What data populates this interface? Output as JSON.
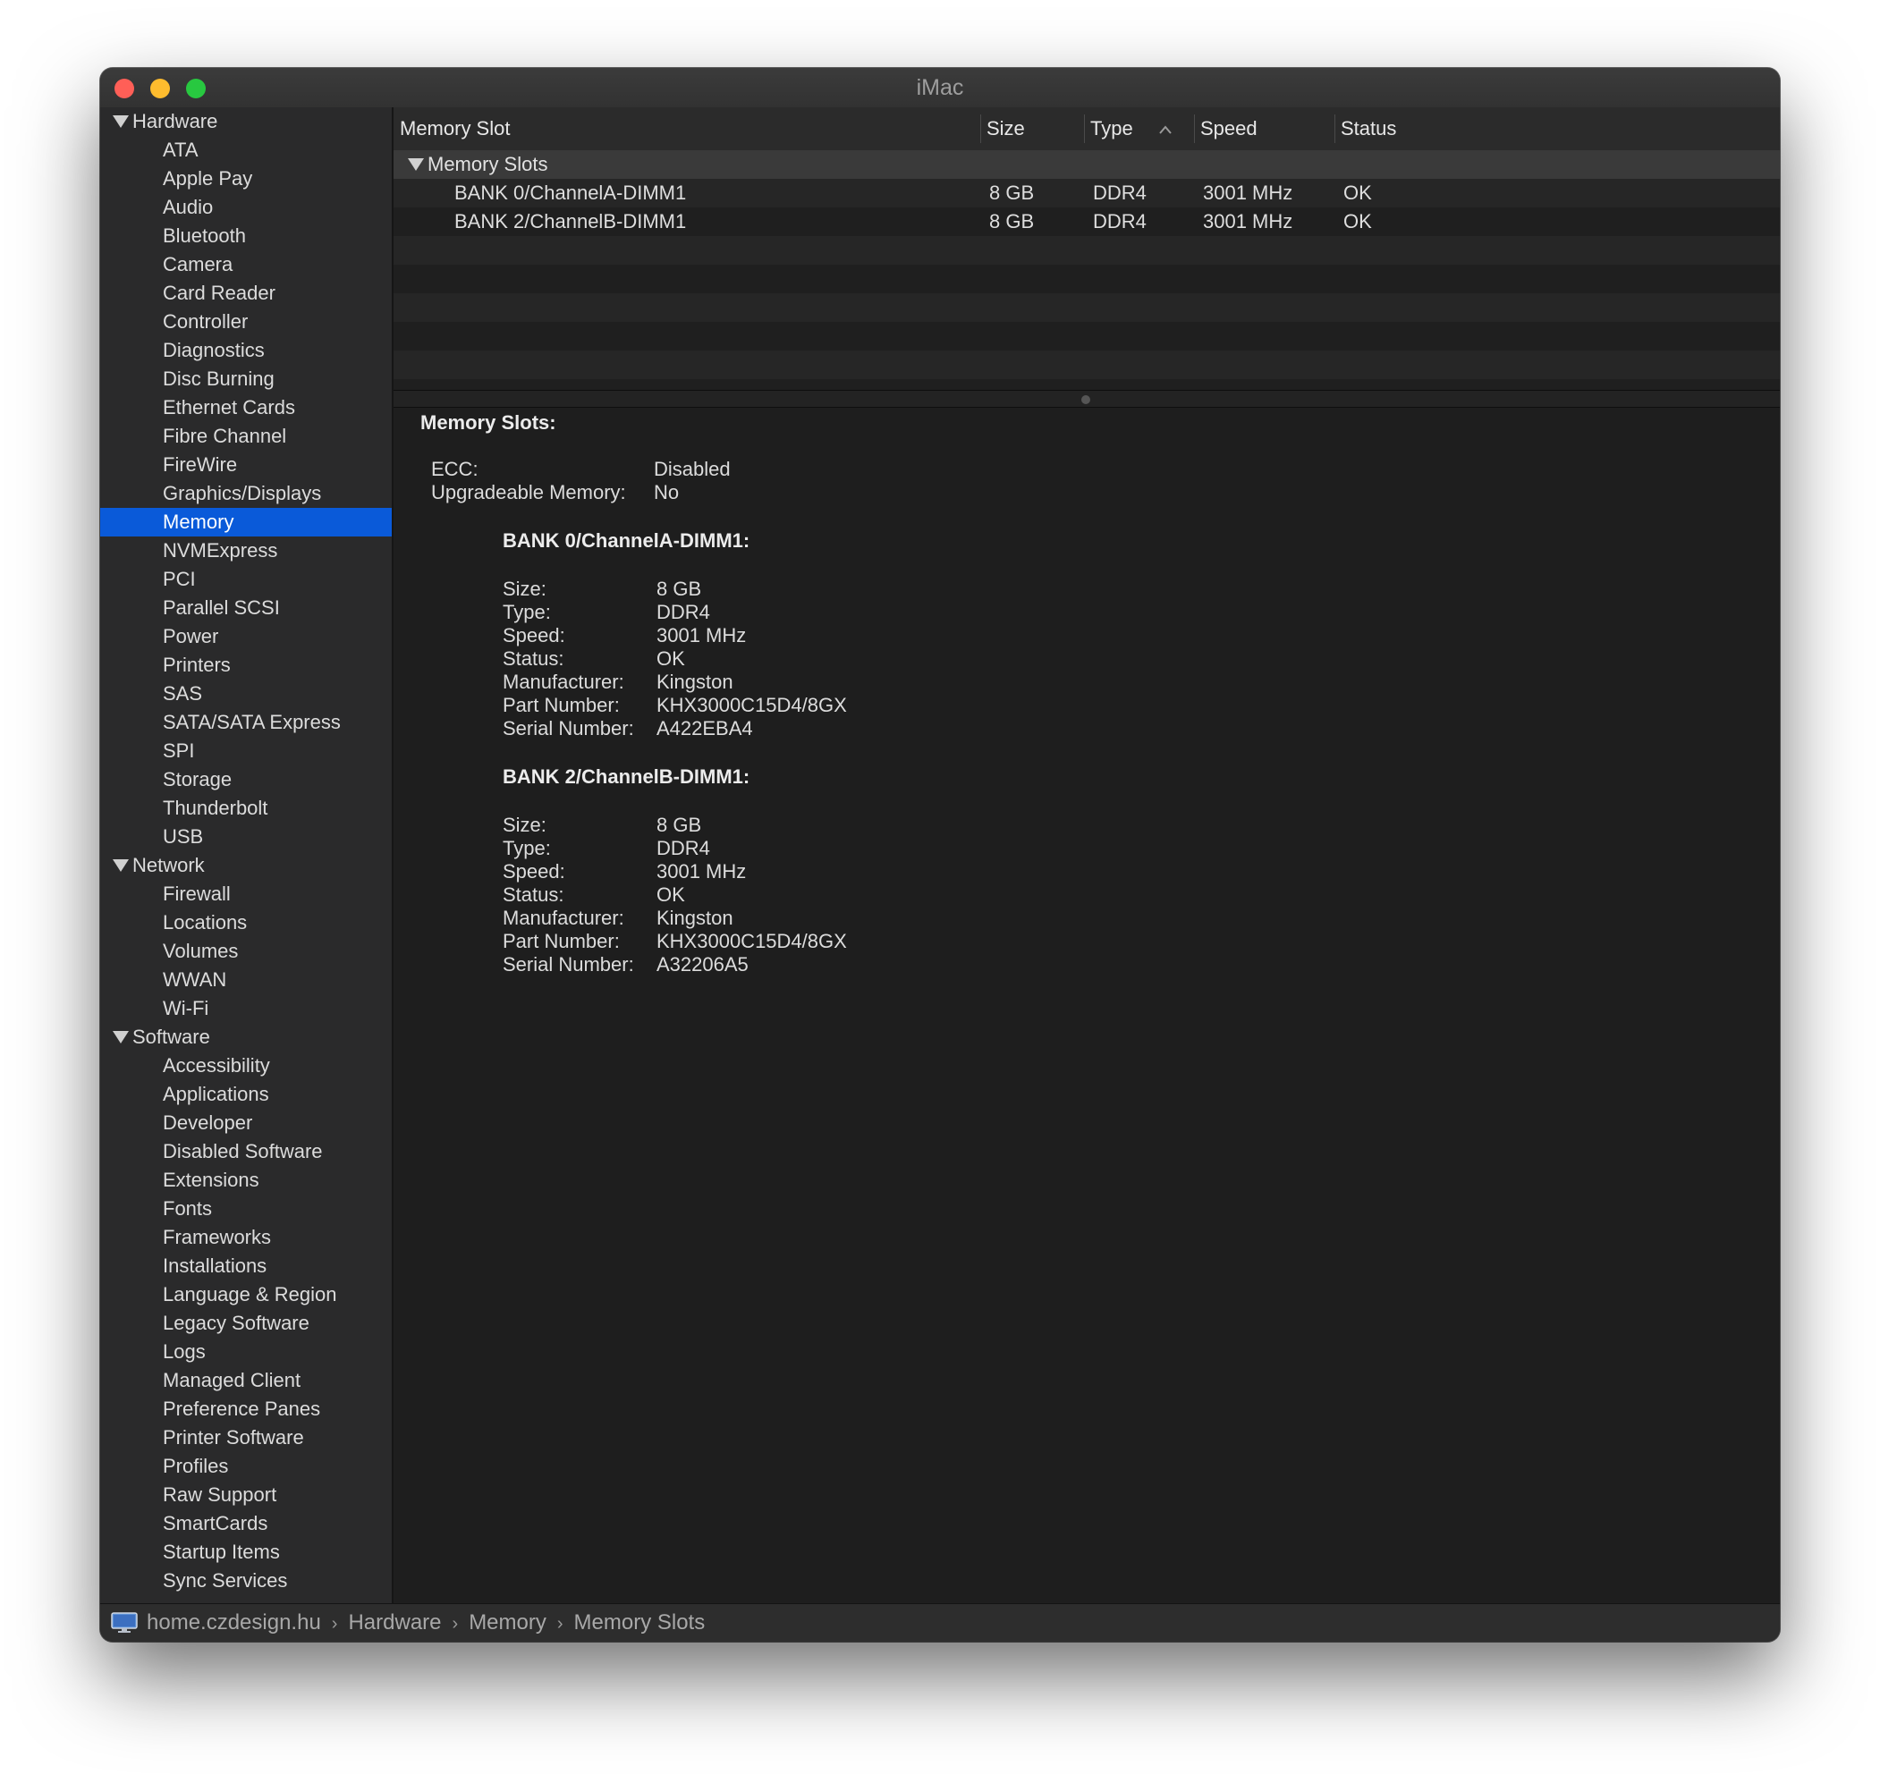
{
  "window": {
    "title": "iMac"
  },
  "sidebar": {
    "groups": [
      {
        "label": "Hardware",
        "items": [
          "ATA",
          "Apple Pay",
          "Audio",
          "Bluetooth",
          "Camera",
          "Card Reader",
          "Controller",
          "Diagnostics",
          "Disc Burning",
          "Ethernet Cards",
          "Fibre Channel",
          "FireWire",
          "Graphics/Displays",
          "Memory",
          "NVMExpress",
          "PCI",
          "Parallel SCSI",
          "Power",
          "Printers",
          "SAS",
          "SATA/SATA Express",
          "SPI",
          "Storage",
          "Thunderbolt",
          "USB"
        ]
      },
      {
        "label": "Network",
        "items": [
          "Firewall",
          "Locations",
          "Volumes",
          "WWAN",
          "Wi-Fi"
        ]
      },
      {
        "label": "Software",
        "items": [
          "Accessibility",
          "Applications",
          "Developer",
          "Disabled Software",
          "Extensions",
          "Fonts",
          "Frameworks",
          "Installations",
          "Language & Region",
          "Legacy Software",
          "Logs",
          "Managed Client",
          "Preference Panes",
          "Printer Software",
          "Profiles",
          "Raw Support",
          "SmartCards",
          "Startup Items",
          "Sync Services"
        ]
      }
    ],
    "selected": "Memory"
  },
  "table": {
    "columns": [
      "Memory Slot",
      "Size",
      "Type",
      "Speed",
      "Status"
    ],
    "sort_indicator": "chevron-up-icon",
    "group_label": "Memory Slots",
    "rows": [
      {
        "slot": "BANK 0/ChannelA-DIMM1",
        "size": "8 GB",
        "type": "DDR4",
        "speed": "3001 MHz",
        "status": "OK"
      },
      {
        "slot": "BANK 2/ChannelB-DIMM1",
        "size": "8 GB",
        "type": "DDR4",
        "speed": "3001 MHz",
        "status": "OK"
      }
    ]
  },
  "detail": {
    "heading": "Memory Slots:",
    "summary": [
      {
        "label": "ECC:",
        "value": "Disabled"
      },
      {
        "label": "Upgradeable Memory:",
        "value": "No"
      }
    ],
    "banks": [
      {
        "title": "BANK 0/ChannelA-DIMM1:",
        "fields": [
          {
            "label": "Size:",
            "value": "8 GB"
          },
          {
            "label": "Type:",
            "value": "DDR4"
          },
          {
            "label": "Speed:",
            "value": "3001 MHz"
          },
          {
            "label": "Status:",
            "value": "OK"
          },
          {
            "label": "Manufacturer:",
            "value": "Kingston"
          },
          {
            "label": "Part Number:",
            "value": "KHX3000C15D4/8GX"
          },
          {
            "label": "Serial Number:",
            "value": "A422EBA4"
          }
        ]
      },
      {
        "title": "BANK 2/ChannelB-DIMM1:",
        "fields": [
          {
            "label": "Size:",
            "value": "8 GB"
          },
          {
            "label": "Type:",
            "value": "DDR4"
          },
          {
            "label": "Speed:",
            "value": "3001 MHz"
          },
          {
            "label": "Status:",
            "value": "OK"
          },
          {
            "label": "Manufacturer:",
            "value": "Kingston"
          },
          {
            "label": "Part Number:",
            "value": "KHX3000C15D4/8GX"
          },
          {
            "label": "Serial Number:",
            "value": "A32206A5"
          }
        ]
      }
    ]
  },
  "pathbar": {
    "icon": "imac-icon",
    "segments": [
      "home.czdesign.hu",
      "Hardware",
      "Memory",
      "Memory Slots"
    ]
  },
  "colors": {
    "selection": "#0a5ad9",
    "close": "#ff5f57",
    "minimize": "#febc2e",
    "zoom": "#28c840"
  }
}
